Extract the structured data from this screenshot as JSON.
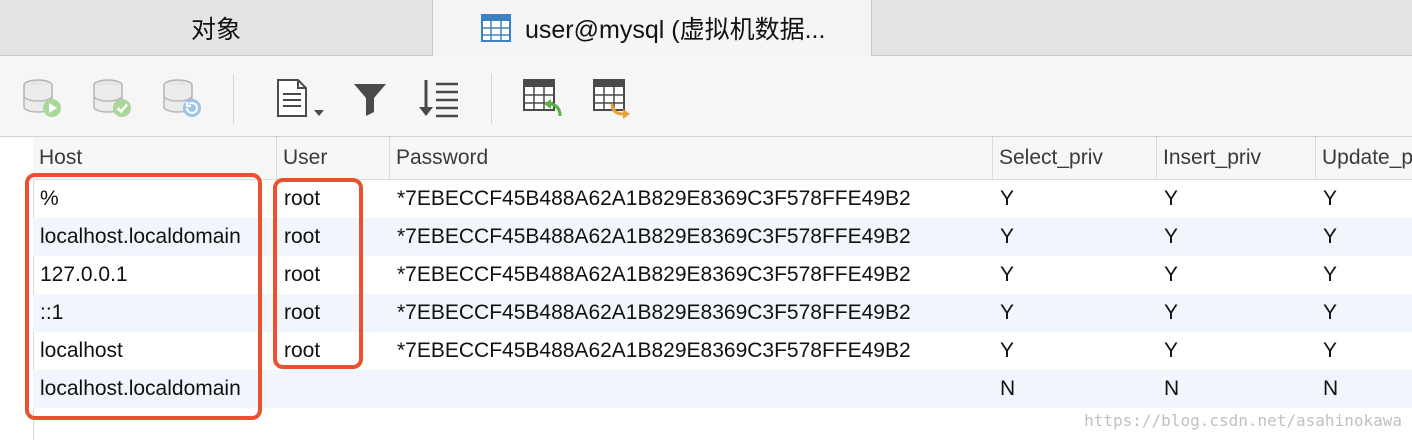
{
  "tabs": [
    {
      "label": "对象",
      "active": false
    },
    {
      "label": "user@mysql (虚拟机数据...",
      "active": true,
      "icon": "table-icon"
    }
  ],
  "toolbar": {
    "buttons": [
      {
        "name": "begin-transaction",
        "icon": "database-play-icon",
        "enabled": false
      },
      {
        "name": "commit",
        "icon": "database-check-icon",
        "enabled": false
      },
      {
        "name": "rollback",
        "icon": "database-refresh-icon",
        "enabled": false
      },
      {
        "name": "text-view",
        "icon": "document-dropdown-icon",
        "enabled": true
      },
      {
        "name": "filter",
        "icon": "funnel-icon",
        "enabled": true
      },
      {
        "name": "sort",
        "icon": "sort-icon",
        "enabled": true
      },
      {
        "name": "import",
        "icon": "table-import-icon",
        "enabled": true
      },
      {
        "name": "export",
        "icon": "table-export-icon",
        "enabled": true
      }
    ]
  },
  "grid": {
    "columns": [
      "Host",
      "User",
      "Password",
      "Select_priv",
      "Insert_priv",
      "Update_p"
    ],
    "rows": [
      {
        "host": "%",
        "user": "root",
        "password": "*7EBECCF45B488A62A1B829E8369C3F578FFE49B2",
        "select_priv": "Y",
        "insert_priv": "Y",
        "update_priv": "Y"
      },
      {
        "host": "localhost.localdomain",
        "user": "root",
        "password": "*7EBECCF45B488A62A1B829E8369C3F578FFE49B2",
        "select_priv": "Y",
        "insert_priv": "Y",
        "update_priv": "Y"
      },
      {
        "host": "127.0.0.1",
        "user": "root",
        "password": "*7EBECCF45B488A62A1B829E8369C3F578FFE49B2",
        "select_priv": "Y",
        "insert_priv": "Y",
        "update_priv": "Y"
      },
      {
        "host": "::1",
        "user": "root",
        "password": "*7EBECCF45B488A62A1B829E8369C3F578FFE49B2",
        "select_priv": "Y",
        "insert_priv": "Y",
        "update_priv": "Y"
      },
      {
        "host": "localhost",
        "user": "root",
        "password": "*7EBECCF45B488A62A1B829E8369C3F578FFE49B2",
        "select_priv": "Y",
        "insert_priv": "Y",
        "update_priv": "Y"
      },
      {
        "host": "localhost.localdomain",
        "user": "",
        "password": "",
        "select_priv": "N",
        "insert_priv": "N",
        "update_priv": "N"
      }
    ]
  },
  "annotation_color": "#e8532f",
  "watermark": "https://blog.csdn.net/asahinokawa"
}
